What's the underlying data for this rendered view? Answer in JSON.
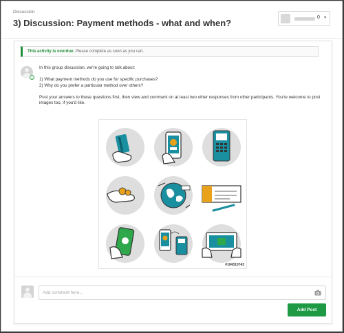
{
  "header": {
    "breadcrumb": "Discussion",
    "title": "3) Discussion: Payment methods - what and when?",
    "user_menu": {
      "count": "0"
    }
  },
  "notice": {
    "strong": "This activity is overdue.",
    "rest": "Please complete as soon as you can."
  },
  "post": {
    "intro": "In this group discussion, we're going to talk about:",
    "question_1": "1) What payment methods do you use for specific purchases?",
    "question_2": "2) Why do you prefer a particular method over others?",
    "closing": "Post your answers to these questions first, then view and comment on at least two other responses from other participants. You're welcome to post images too, if you'd like.",
    "image": {
      "id_label": "#104310743",
      "icons": [
        "card-in-hand-icon",
        "mobile-payment-icon",
        "card-terminal-icon",
        "cash-in-hand-icon",
        "globe-transfer-icon",
        "cheque-icon",
        "phone-tap-icon",
        "phone-to-terminal-icon",
        "laptop-payment-icon"
      ]
    }
  },
  "comment": {
    "placeholder": "Add comment here...",
    "submit_label": "Add Post"
  },
  "colors": {
    "accent_green": "#1e9a45",
    "icon_teal": "#1a8fa0",
    "icon_circle": "#dedede"
  }
}
